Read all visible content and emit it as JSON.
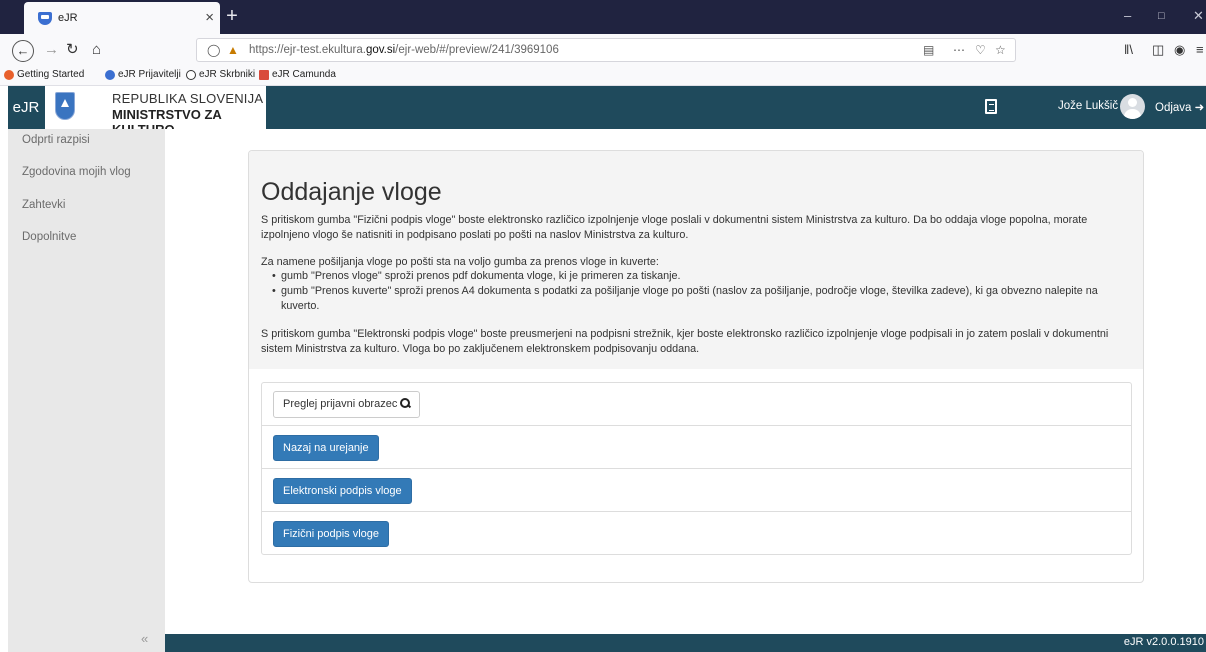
{
  "browser": {
    "tab_title": "eJR",
    "tab_close": "×",
    "new_tab": "+",
    "url_prefix": "https://ejr-test.ekultura.",
    "url_domain": "gov.si",
    "url_suffix": "/ejr-web/#/preview/241/3969106",
    "bookmarks": [
      "Getting Started",
      "eJR Prijavitelji",
      "eJR Skrbniki",
      "eJR Camunda"
    ]
  },
  "header": {
    "brand": "eJR",
    "ministry_line1": "REPUBLIKA SLOVENIJA",
    "ministry_line2": "MINISTRSTVO ZA KULTURO",
    "user_name": "Jože Lukšič",
    "logout_label": "Odjava"
  },
  "sidebar": {
    "items": [
      "Odprti razpisi",
      "Zgodovina mojih vlog",
      "Zahtevki",
      "Dopolnitve"
    ],
    "collapse_label": "«"
  },
  "main": {
    "title": "Oddajanje vloge",
    "para1": "S pritiskom gumba \"Fizični podpis vloge\" boste elektronsko različico izpolnjenje vloge poslali v dokumentni sistem Ministrstva za kulturo. Da bo oddaja vloge popolna, morate izpolnjeno vlogo še natisniti in podpisano poslati po pošti na naslov Ministrstva za kulturo.",
    "para2": "Za namene pošiljanja vloge po pošti sta na voljo gumba za prenos vloge in kuverte:",
    "bullet1": "gumb \"Prenos vloge\" sproži prenos pdf dokumenta vloge, ki je primeren za tiskanje.",
    "bullet2": "gumb \"Prenos kuverte\" sproži prenos A4 dokumenta s podatki za pošiljanje vloge po pošti (naslov za pošiljanje, področje vloge, številka zadeve), ki ga obvezno nalepite na kuverto.",
    "para3": "S pritiskom gumba \"Elektronski podpis vloge\" boste preusmerjeni na podpisni strežnik, kjer boste elektronsko različico izpolnjenje vloge podpisali in jo zatem poslali v dokumentni sistem Ministrstva za kulturo. Vloga bo po zaključenem elektronskem podpisovanju oddana.",
    "btn_preview": "Preglej prijavni obrazec",
    "btn_back": "Nazaj na urejanje",
    "btn_esign": "Elektronski podpis vloge",
    "btn_psign": "Fizični podpis vloge"
  },
  "footer": {
    "version": "eJR v2.0.0.1910"
  },
  "colors": {
    "header_bg": "#1f4a5c",
    "sidebar_bg": "#e8e8e8",
    "primary": "#337ab7",
    "browser_dark": "#202340"
  }
}
